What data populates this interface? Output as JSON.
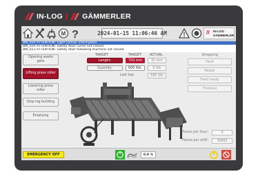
{
  "brand": {
    "name_left": "IN-LOG",
    "separator": "|",
    "name_right": "GÄMMERLER"
  },
  "header": {
    "datetime": "2024-01-15 11:06:46 AM",
    "logo_line1": "IN-LOG",
    "logo_line2": "GÄMMERLER"
  },
  "messages": [
    "BM_024 ATTENTION: Light curtain interrupted",
    "BM_024 ATTENTION: Safety door curve not closed",
    "BM_023 ATTENTION: Safety door following machine not closed"
  ],
  "left_buttons": [
    {
      "label": "Opening waste gate",
      "active": false
    },
    {
      "label": "Lifting press roller",
      "active": true
    },
    {
      "label": "Lowering press roller",
      "active": false
    },
    {
      "label": "Stop log building",
      "active": false
    },
    {
      "label": "Emptying",
      "active": false
    }
  ],
  "table": {
    "col_target": "TARGET",
    "col_target2": "TARGET",
    "col_actual": "ACTUAL",
    "length_label": "Lenght:",
    "length_target": "750 mm",
    "length_actual": "32 mm",
    "quantity_label": "Quantity:",
    "quantity_target": "600 Stk.",
    "quantity_actual": "0 Stk",
    "lasttop_label": "Last top:",
    "lasttop_value": "585 Stk"
  },
  "strapping": {
    "title": "Strapping",
    "buttons": [
      "Fault",
      "Ready",
      "Feed ready",
      "Finished"
    ]
  },
  "stats": {
    "per_hour_label": "Pieces per hour:",
    "per_hour_value": "0",
    "per_shift_label": "Pieces per shift:",
    "per_shift_value": "39893"
  },
  "bottom": {
    "emergency_label": "EMERGENCY OFF",
    "percentage": "0.0 %"
  },
  "colors": {
    "accent_red": "#a3142b",
    "emergency_yellow": "#f6ec1a",
    "start_green": "#2bb32b",
    "power_yellow": "#f3d20c"
  },
  "icons": [
    "home-icon",
    "tools-icon",
    "cart-icon",
    "manual-mode-icon",
    "help-icon",
    "warning-icon",
    "no-entry-icon",
    "start-icon",
    "speed-icon",
    "power-icon",
    "stop-icon"
  ]
}
